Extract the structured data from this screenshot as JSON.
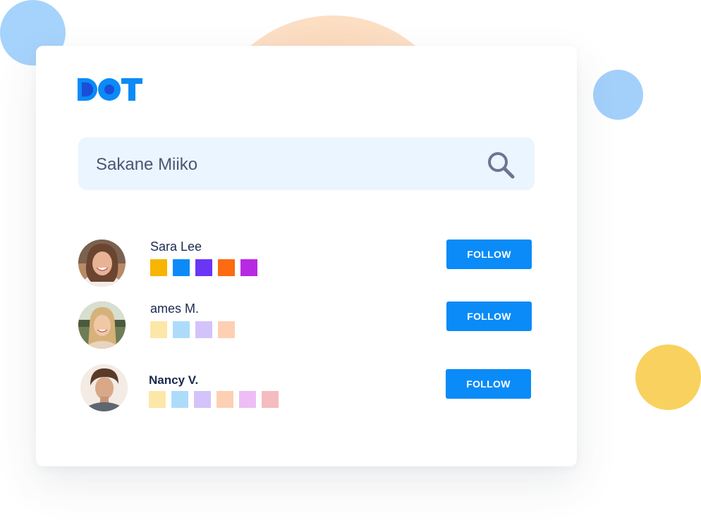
{
  "brand": {
    "logo": "DOT",
    "primary_color": "#0a8bf7",
    "logo_dot_color": "#1b4ed8"
  },
  "search": {
    "value": "Sakane Miiko",
    "icon": "search-icon",
    "icon_color": "#6b7593"
  },
  "users": [
    {
      "name": "Sara Lee",
      "avatar": "avatar-photo",
      "swatches": [
        "#f7b500",
        "#0a8bf7",
        "#6a35f5",
        "#fc6a12",
        "#b829e3"
      ],
      "follow_label": "FOLLOW"
    },
    {
      "name": "ames M.",
      "avatar": "avatar-photo",
      "swatches": [
        "#fde7a8",
        "#addcfb",
        "#d3c3fa",
        "#fdd0b4"
      ],
      "follow_label": "FOLLOW"
    },
    {
      "name": "Nancy V.",
      "avatar": "avatar-photo",
      "swatches": [
        "#fde7a8",
        "#addcfb",
        "#d3c3fa",
        "#fdd0b4",
        "#eebdf6",
        "#f4bcbe"
      ],
      "follow_label": "FOLLOW"
    }
  ]
}
